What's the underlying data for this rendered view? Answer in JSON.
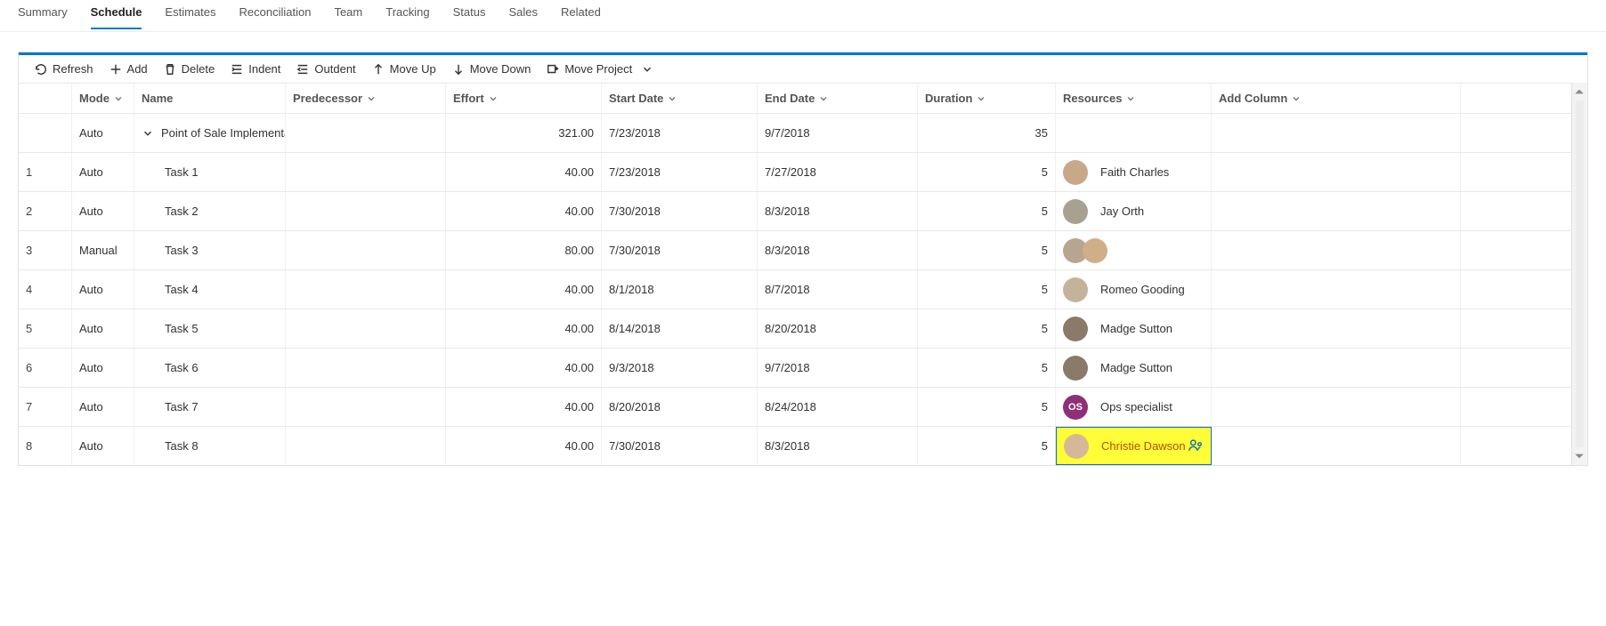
{
  "tabs": [
    "Summary",
    "Schedule",
    "Estimates",
    "Reconciliation",
    "Team",
    "Tracking",
    "Status",
    "Sales",
    "Related"
  ],
  "active_tab": "Schedule",
  "toolbar": {
    "refresh": "Refresh",
    "add": "Add",
    "delete": "Delete",
    "indent": "Indent",
    "outdent": "Outdent",
    "moveup": "Move Up",
    "movedown": "Move Down",
    "moveproject": "Move Project"
  },
  "columns": {
    "mode": "Mode",
    "name": "Name",
    "predecessor": "Predecessor",
    "effort": "Effort",
    "start": "Start Date",
    "end": "End Date",
    "duration": "Duration",
    "resources": "Resources",
    "addcol": "Add Column"
  },
  "project": {
    "mode": "Auto",
    "name": "Point of Sale Implementat",
    "effort": "321.00",
    "start": "7/23/2018",
    "end": "9/7/2018",
    "duration": "35"
  },
  "rows": [
    {
      "idx": "1",
      "mode": "Auto",
      "name": "Task 1",
      "effort": "40.00",
      "start": "7/23/2018",
      "end": "7/27/2018",
      "duration": "5",
      "resAvatar": "photo",
      "resName": "Faith Charles"
    },
    {
      "idx": "2",
      "mode": "Auto",
      "name": "Task 2",
      "effort": "40.00",
      "start": "7/30/2018",
      "end": "8/3/2018",
      "duration": "5",
      "resAvatar": "photo",
      "resName": "Jay Orth"
    },
    {
      "idx": "3",
      "mode": "Manual",
      "name": "Task 3",
      "effort": "80.00",
      "start": "7/30/2018",
      "end": "8/3/2018",
      "duration": "5",
      "resAvatar": "group",
      "resName": ""
    },
    {
      "idx": "4",
      "mode": "Auto",
      "name": "Task 4",
      "effort": "40.00",
      "start": "8/1/2018",
      "end": "8/7/2018",
      "duration": "5",
      "resAvatar": "photo",
      "resName": "Romeo Gooding"
    },
    {
      "idx": "5",
      "mode": "Auto",
      "name": "Task 5",
      "effort": "40.00",
      "start": "8/14/2018",
      "end": "8/20/2018",
      "duration": "5",
      "resAvatar": "photo",
      "resName": "Madge Sutton"
    },
    {
      "idx": "6",
      "mode": "Auto",
      "name": "Task 6",
      "effort": "40.00",
      "start": "9/3/2018",
      "end": "9/7/2018",
      "duration": "5",
      "resAvatar": "photo",
      "resName": "Madge Sutton"
    },
    {
      "idx": "7",
      "mode": "Auto",
      "name": "Task 7",
      "effort": "40.00",
      "start": "8/20/2018",
      "end": "8/24/2018",
      "duration": "5",
      "resAvatar": "ops",
      "resName": "Ops specialist"
    },
    {
      "idx": "8",
      "mode": "Auto",
      "name": "Task 8",
      "effort": "40.00",
      "start": "7/30/2018",
      "end": "8/3/2018",
      "duration": "5",
      "resAvatar": "photo",
      "resName": "Christie Dawson",
      "highlight": true
    }
  ],
  "avatarColors": [
    "#c9a88a",
    "#a8a090",
    "#bda07a",
    "#c4b39a",
    "#8a7a6a",
    "#8a7a6a",
    "#8e2f77",
    "#d6b898"
  ]
}
